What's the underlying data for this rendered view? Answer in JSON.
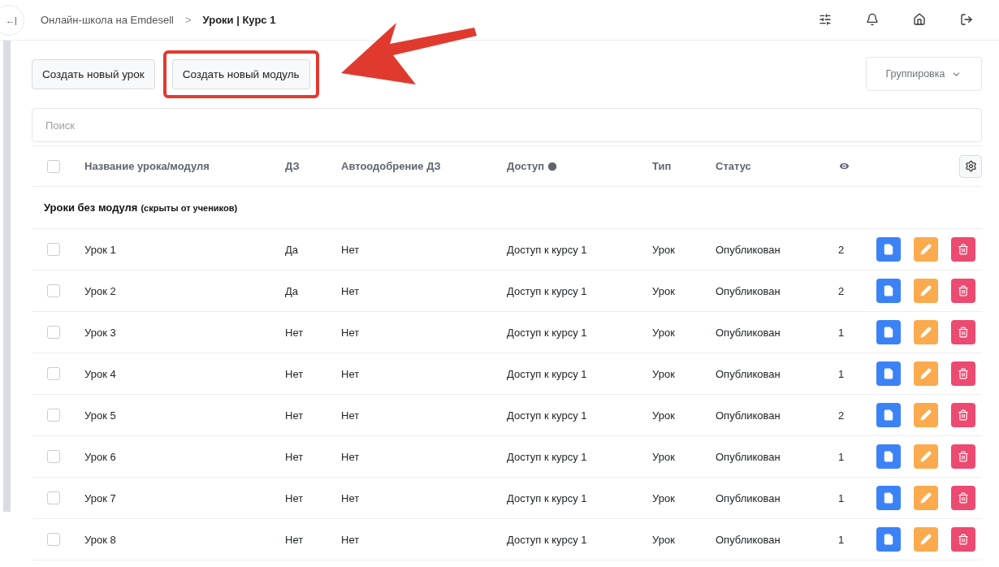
{
  "breadcrumb": {
    "items": [
      "Онлайн-школа на Emdesell"
    ],
    "separator": ">",
    "current": "Уроки | Курс 1"
  },
  "collapse_button": "←|",
  "toolbar": {
    "buttons": [
      {
        "label": "Создать новый урок",
        "highlighted": false
      },
      {
        "label": "Создать новый модуль",
        "highlighted": true
      }
    ],
    "grouping": "Группировка"
  },
  "search": {
    "placeholder": "Поиск"
  },
  "table": {
    "select_all_checked": false,
    "columns": [
      "Название урока/модуля",
      "ДЗ",
      "Автоодобрение ДЗ",
      "Доступ",
      "Тип",
      "Статус"
    ],
    "group": {
      "title": "Уроки без модуля",
      "note": "(скрыты от учеников)"
    },
    "rows": [
      {
        "checked": false,
        "name": "Урок 1",
        "hw": "Да",
        "auto": "Нет",
        "access": "Доступ к курсу 1",
        "type": "Урок",
        "status": "Опубликован",
        "views": "2"
      },
      {
        "checked": false,
        "name": "Урок 2",
        "hw": "Да",
        "auto": "Нет",
        "access": "Доступ к курсу 1",
        "type": "Урок",
        "status": "Опубликован",
        "views": "2"
      },
      {
        "checked": false,
        "name": "Урок 3",
        "hw": "Нет",
        "auto": "Нет",
        "access": "Доступ к курсу 1",
        "type": "Урок",
        "status": "Опубликован",
        "views": "1"
      },
      {
        "checked": false,
        "name": "Урок 4",
        "hw": "Нет",
        "auto": "Нет",
        "access": "Доступ к курсу 1",
        "type": "Урок",
        "status": "Опубликован",
        "views": "1"
      },
      {
        "checked": false,
        "name": "Урок 5",
        "hw": "Нет",
        "auto": "Нет",
        "access": "Доступ к курсу 1",
        "type": "Урок",
        "status": "Опубликован",
        "views": "2"
      },
      {
        "checked": false,
        "name": "Урок 6",
        "hw": "Нет",
        "auto": "Нет",
        "access": "Доступ к курсу 1",
        "type": "Урок",
        "status": "Опубликован",
        "views": "1"
      },
      {
        "checked": false,
        "name": "Урок 7",
        "hw": "Нет",
        "auto": "Нет",
        "access": "Доступ к курсу 1",
        "type": "Урок",
        "status": "Опубликован",
        "views": "1"
      },
      {
        "checked": false,
        "name": "Урок 8",
        "hw": "Нет",
        "auto": "Нет",
        "access": "Доступ к курсу 1",
        "type": "Урок",
        "status": "Опубликован",
        "views": "1"
      }
    ]
  }
}
